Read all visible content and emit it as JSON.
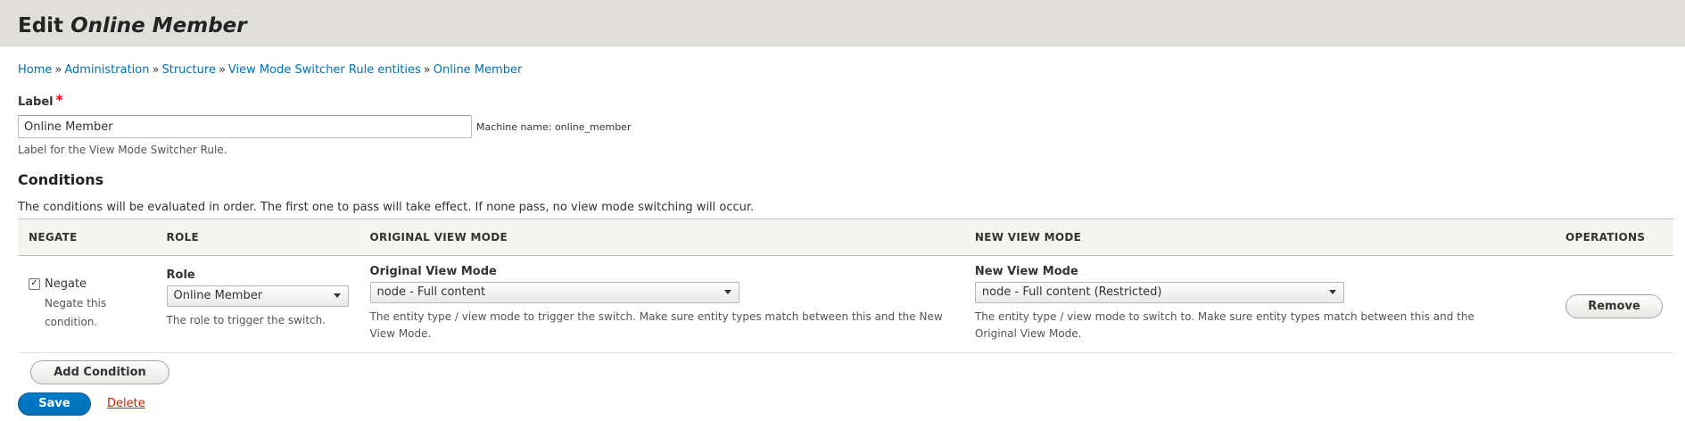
{
  "header": {
    "title_prefix": "Edit ",
    "title_entity": "Online Member"
  },
  "breadcrumb": [
    "Home",
    "Administration",
    "Structure",
    "View Mode Switcher Rule entities",
    "Online Member"
  ],
  "form": {
    "label_field": {
      "label": "Label",
      "required_mark": "*",
      "value": "Online Member",
      "machine_name": "Machine name: online_member",
      "description": "Label for the View Mode Switcher Rule."
    },
    "conditions": {
      "title": "Conditions",
      "description": "The conditions will be evaluated in order. The first one to pass will take effect. If none pass, no view mode switching will occur.",
      "columns": [
        "Negate",
        "Role",
        "Original View Mode",
        "New View Mode",
        "Operations"
      ],
      "rows": [
        {
          "negate_label": "Negate",
          "negate_checked": true,
          "negate_description": "Negate this condition.",
          "role_label": "Role",
          "role_value": "Online Member",
          "role_description": "The role to trigger the switch.",
          "original_label": "Original View Mode",
          "original_value": "node - Full content",
          "original_description": "The entity type / view mode to trigger the switch. Make sure entity types match between this and the New View Mode.",
          "new_label": "New View Mode",
          "new_value": "node - Full content (Restricted)",
          "new_description": "The entity type / view mode to switch to. Make sure entity types match between this and the Original View Mode.",
          "remove_label": "Remove"
        }
      ],
      "add_label": "Add Condition"
    },
    "save_label": "Save",
    "delete_label": "Delete"
  },
  "colors": {
    "header_bg": "#e0dfdb",
    "link": "#0071b8",
    "primary_button": "#0071b8",
    "delete_link": "#c72100",
    "required": "#ee0000"
  }
}
